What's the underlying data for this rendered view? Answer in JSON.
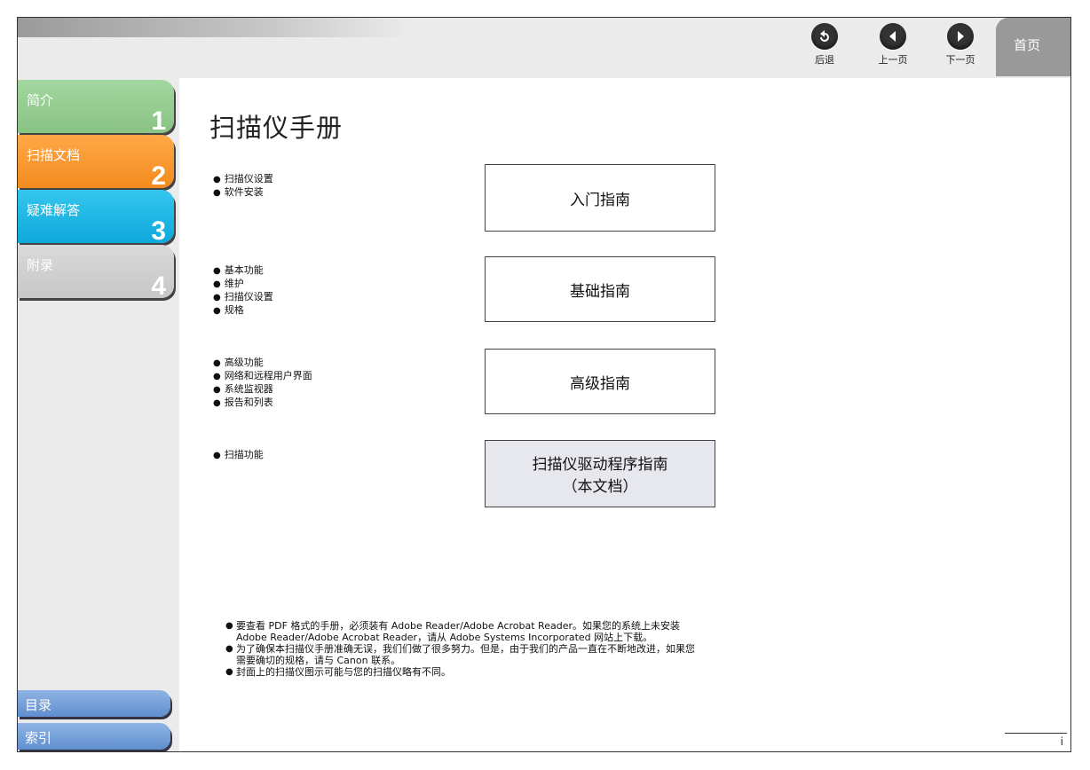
{
  "nav": {
    "back_label": "后退",
    "prev_label": "上一页",
    "next_label": "下一页",
    "home_label": "首页"
  },
  "sidebar": {
    "tabs": [
      {
        "label": "简介",
        "number": "1"
      },
      {
        "label": "扫描文档",
        "number": "2"
      },
      {
        "label": "疑难解答",
        "number": "3"
      },
      {
        "label": "附录",
        "number": "4"
      }
    ],
    "contents_label": "目录",
    "index_label": "索引"
  },
  "main": {
    "title": "扫描仪手册",
    "guides": [
      {
        "bullets": [
          "扫描仪设置",
          "软件安装"
        ],
        "label": "入门指南",
        "sublabel": ""
      },
      {
        "bullets": [
          "基本功能",
          "维护",
          "扫描仪设置",
          "规格"
        ],
        "label": "基础指南",
        "sublabel": ""
      },
      {
        "bullets": [
          "高级功能",
          "网络和远程用户界面",
          "系统监视器",
          "报告和列表"
        ],
        "label": "高级指南",
        "sublabel": ""
      },
      {
        "bullets": [
          "扫描功能"
        ],
        "label": "扫描仪驱动程序指南",
        "sublabel": "（本文档）"
      }
    ],
    "notes": [
      {
        "line1": "要查看 PDF 格式的手册，必须装有 Adobe Reader/Adobe Acrobat Reader。如果您的系统上未安装",
        "line2": "Adobe Reader/Adobe Acrobat Reader，请从 Adobe Systems Incorporated 网站上下载。"
      },
      {
        "line1": "为了确保本扫描仪手册准确无误，我们们做了很多努力。但是，由于我们的产品一直在不断地改进，如果您",
        "line2": "需要确切的规格，请与 Canon 联系。"
      },
      {
        "line1": "封面上的扫描仪图示可能与您的扫描仪略有不同。",
        "line2": ""
      }
    ],
    "page_number": "i"
  },
  "colors": {
    "intro_tab": "#89c384",
    "scan_tab": "#f28b1e",
    "trouble_tab": "#0fa8db",
    "appendix_tab": "#c7c7c7",
    "small_tabs": "#5f8fcf"
  },
  "icons": [
    "back-icon",
    "prev-page-icon",
    "next-page-icon"
  ]
}
